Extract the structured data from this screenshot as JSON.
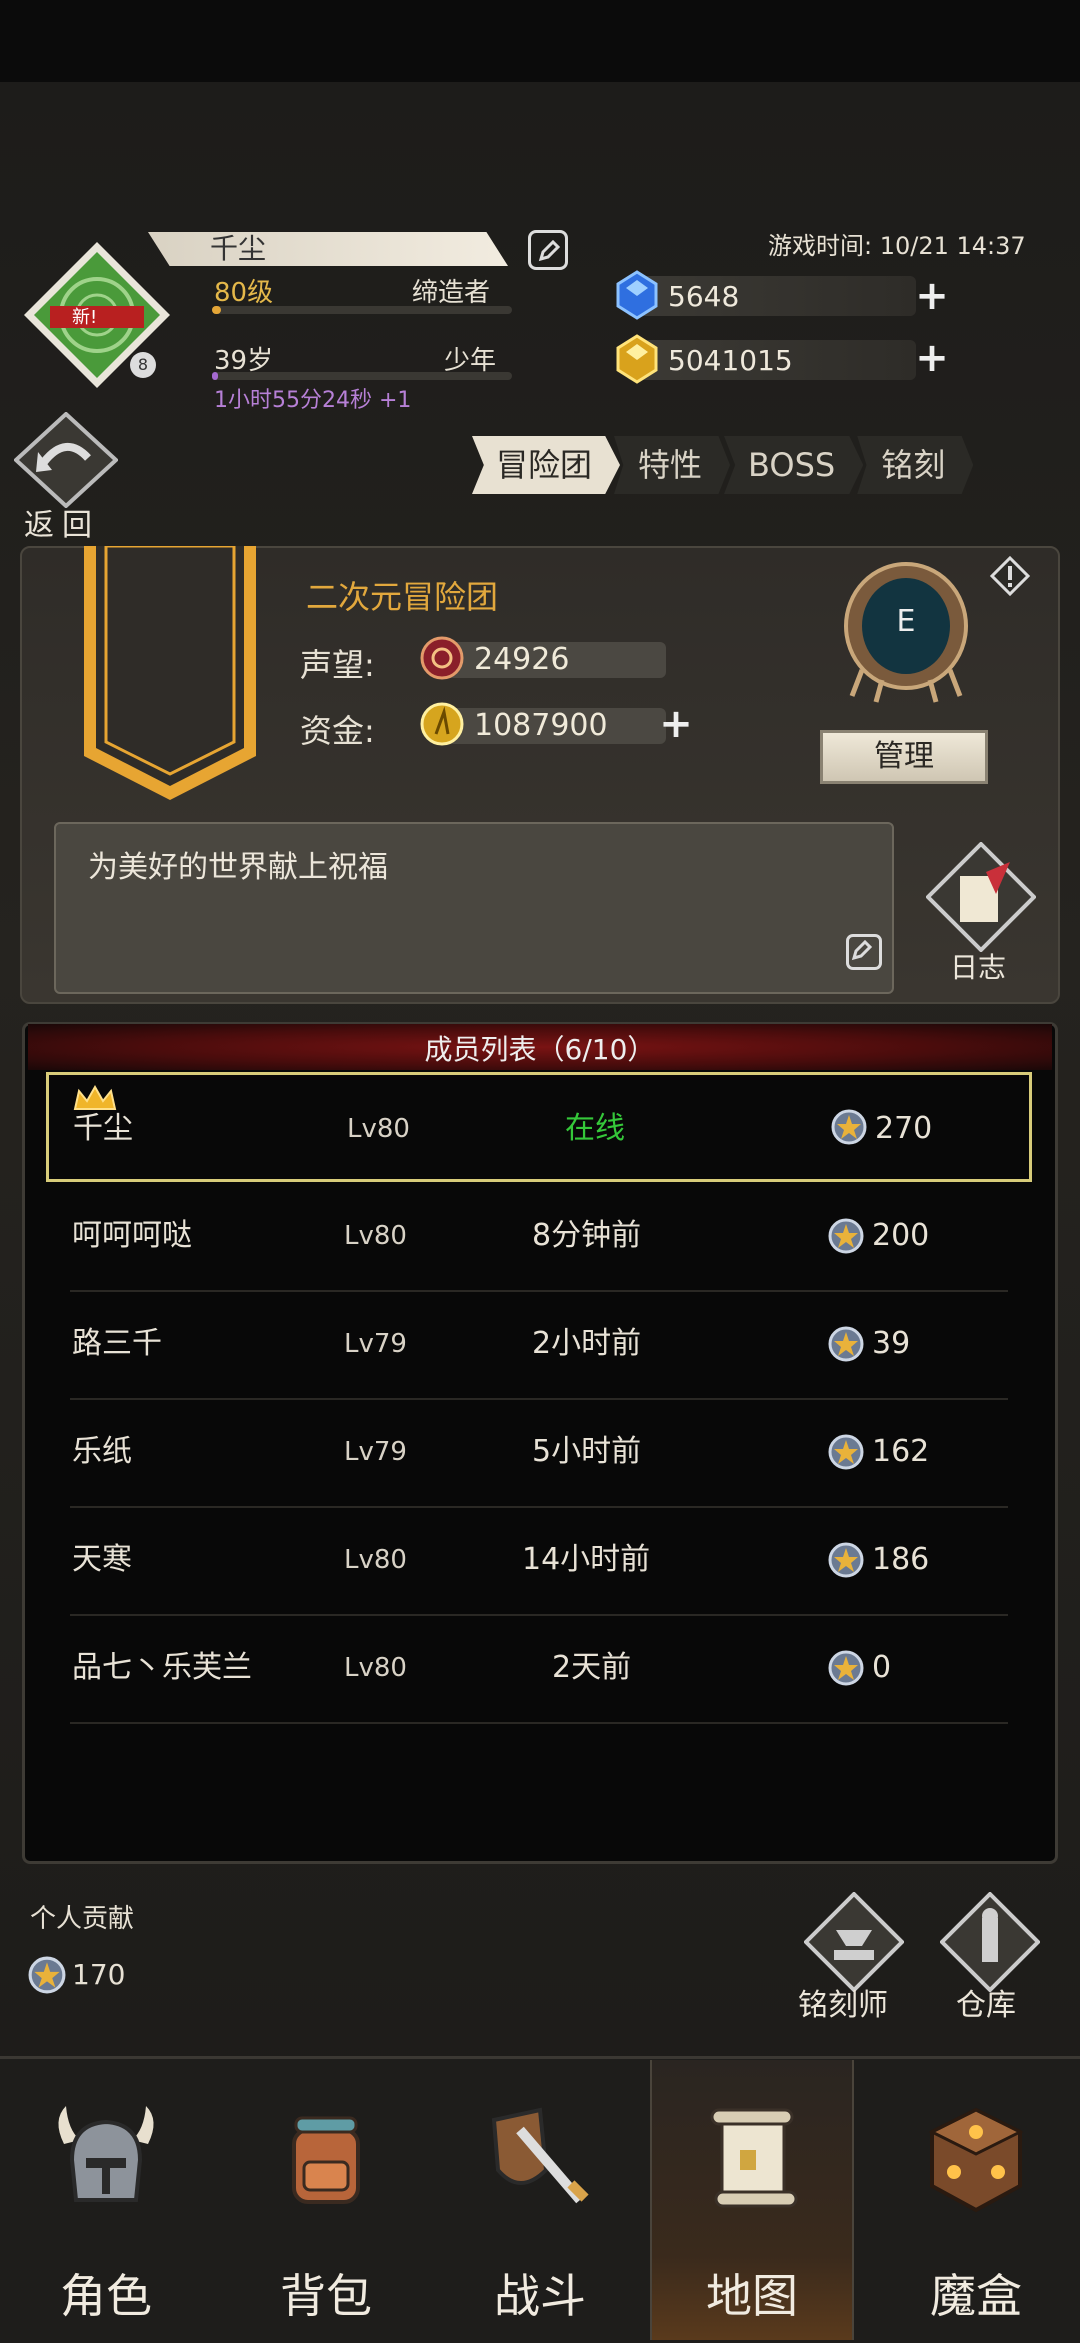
{
  "header": {
    "player_name": "千尘",
    "level": "80级",
    "class": "缔造者",
    "age": "39岁",
    "life_stage": "少年",
    "timer": "1小时55分24秒 +1",
    "avatar_badge": "新!",
    "avatar_small_badge": "8",
    "game_time": "游戏时间: 10/21 14:37",
    "gems": "5648",
    "gold": "5041015",
    "level_progress": 0.03,
    "age_progress": 0.02
  },
  "back_label": "返回",
  "tabs": [
    {
      "label": "冒险团",
      "active": true
    },
    {
      "label": "特性",
      "active": false
    },
    {
      "label": "BOSS",
      "active": false
    },
    {
      "label": "铭刻",
      "active": false
    }
  ],
  "guild": {
    "name": "二次元冒险团",
    "reputation_label": "声望:",
    "reputation": "24926",
    "funds_label": "资金:",
    "funds": "1087900",
    "emblem_letter": "E",
    "manage_label": "管理",
    "motto": "为美好的世界献上祝福",
    "log_label": "日志"
  },
  "members": {
    "title": "成员列表（6/10）",
    "rows": [
      {
        "name": "千尘",
        "level": "Lv80",
        "status": "在线",
        "contribution": "270",
        "leader": true
      },
      {
        "name": "呵呵呵哒",
        "level": "Lv80",
        "status": "8分钟前",
        "contribution": "200",
        "leader": false
      },
      {
        "name": "路三千",
        "level": "Lv79",
        "status": "2小时前",
        "contribution": "39",
        "leader": false
      },
      {
        "name": "乐纸",
        "level": "Lv79",
        "status": "5小时前",
        "contribution": "162",
        "leader": false
      },
      {
        "name": "天寒",
        "level": "Lv80",
        "status": "14小时前",
        "contribution": "186",
        "leader": false
      },
      {
        "name": "品七丶乐芙兰",
        "level": "Lv80",
        "status": "2天前",
        "contribution": "0",
        "leader": false
      }
    ]
  },
  "personal": {
    "label": "个人贡献",
    "value": "170"
  },
  "shortcuts": {
    "engraver": "铭刻师",
    "warehouse": "仓库"
  },
  "nav": [
    {
      "label": "角色",
      "active": false
    },
    {
      "label": "背包",
      "active": false
    },
    {
      "label": "战斗",
      "active": false
    },
    {
      "label": "地图",
      "active": true
    },
    {
      "label": "魔盒",
      "active": false
    }
  ],
  "colors": {
    "online": "#35c83a",
    "accent_gold": "#e2a83d",
    "header_red": "#7a1313"
  }
}
